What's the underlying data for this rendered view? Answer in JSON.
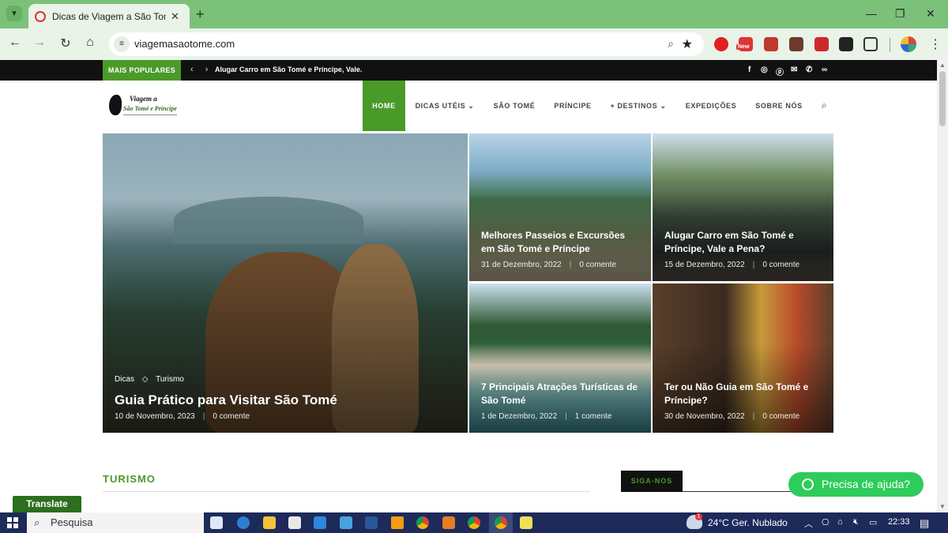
{
  "browser": {
    "tab_title": "Dicas de Viagem a São Tomé e",
    "url": "viagemasaotome.com",
    "extensions": [
      {
        "name": "opera-ext-icon",
        "color": "#e02020"
      },
      {
        "name": "new-badge-ext-icon",
        "color": "#d33",
        "badge": "New"
      },
      {
        "name": "s-ext-icon",
        "color": "#c0392b"
      },
      {
        "name": "k-ext-icon",
        "color": "#6b3b2b"
      },
      {
        "name": "red-ext-icon",
        "color": "#cc2a2a"
      },
      {
        "name": "black-ext-icon",
        "color": "#222"
      }
    ]
  },
  "site": {
    "topbar": {
      "popular_label": "MAIS POPULARES",
      "ticker": "Alugar Carro em São Tomé e Príncipe, Vale.",
      "social": [
        "facebook-icon",
        "instagram-icon",
        "pinterest-icon",
        "email-icon",
        "whatsapp-icon",
        "tripadvisor-icon"
      ]
    },
    "logo": {
      "line1": "Viagem a",
      "line2": "São Tomé e Príncipe"
    },
    "menu": [
      {
        "label": "HOME",
        "active": true
      },
      {
        "label": "DICAS UTÉIS",
        "dropdown": true
      },
      {
        "label": "SÃO TOMÉ"
      },
      {
        "label": "PRÍNCIPE"
      },
      {
        "label": "+ DESTINOS",
        "dropdown": true
      },
      {
        "label": "EXPEDIÇÕES"
      },
      {
        "label": "SOBRE NÓS"
      }
    ],
    "featured": {
      "categories": [
        "Dicas",
        "Turismo"
      ],
      "title": "Guia Prático para Visitar São Tomé",
      "date": "10 de Novembro, 2023",
      "comments": "0 comente"
    },
    "posts": [
      {
        "title": "Melhores Passeios e Excursões em São Tomé e Príncipe",
        "date": "31 de Dezembro, 2022",
        "comments": "0 comente"
      },
      {
        "title": "Alugar Carro em São Tomé e Príncipe, Vale a Pena?",
        "date": "15 de Dezembro, 2022",
        "comments": "0 comente"
      },
      {
        "title": "7 Principais Atrações Turísticas de São Tomé",
        "date": "1 de Dezembro, 2022",
        "comments": "1 comente"
      },
      {
        "title": "Ter ou Não Guia em São Tomé e Príncipe?",
        "date": "30 de Novembro, 2022",
        "comments": "0 comente"
      }
    ],
    "section_title": "TURISMO",
    "follow_label": "SIGA-NOS",
    "help_button": "Precisa de ajuda?",
    "translate_button": "Translate"
  },
  "taskbar": {
    "search_placeholder": "Pesquisa",
    "weather": "24°C  Ger. Nublado",
    "weather_badge": "1",
    "time": "22:33"
  },
  "colors": {
    "brand_green": "#4a9a2a",
    "chrome_green": "#7cc17a"
  }
}
